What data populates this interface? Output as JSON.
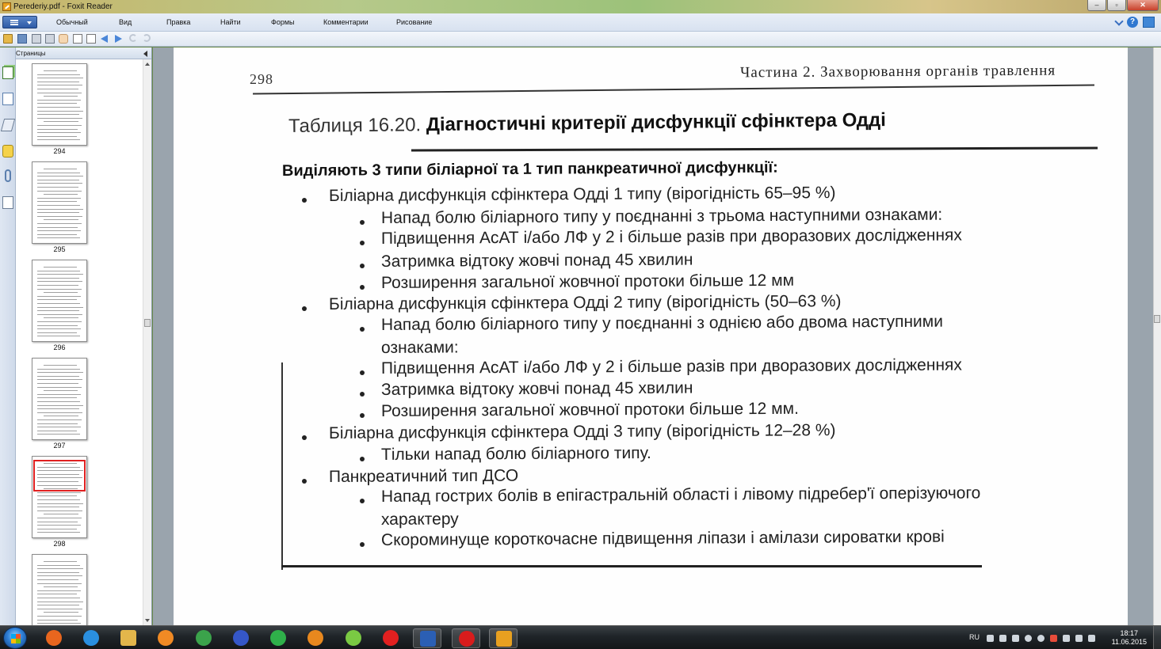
{
  "window": {
    "title": "Perederiy.pdf - Foxit Reader",
    "controls": [
      "‒",
      "▫",
      "✕"
    ]
  },
  "menu": {
    "items": [
      "Обычный",
      "Вид",
      "Правка",
      "Найти",
      "Формы",
      "Комментарии",
      "Рисование"
    ],
    "help_label": "?"
  },
  "sidebar": {
    "title": "Страницы",
    "thumbnails": [
      {
        "label": "294"
      },
      {
        "label": "295"
      },
      {
        "label": "296"
      },
      {
        "label": "297"
      },
      {
        "label": "298",
        "selected": true
      },
      {
        "label": ""
      }
    ]
  },
  "document": {
    "page_number": "298",
    "running_head": "Частина 2. Захворювання органів травлення",
    "caption_prefix": "Таблиця 16.20.",
    "caption_title": "Діагностичні критерії дисфункції сфінктера Одді",
    "intro": "Виділяють 3 типи біліарної та 1 тип панкреатичної дисфункції:",
    "items": [
      {
        "level": 1,
        "text": "Біліарна дисфункція сфінктера Одді 1 типу (вірогідність 65–95 %)"
      },
      {
        "level": 2,
        "text": "Напад болю біліарного типу у поєднанні з трьома наступними ознаками:"
      },
      {
        "level": 2,
        "text": "Підвищення АсАТ і/або ЛФ у 2 і більше разів при дворазових дослідженнях"
      },
      {
        "level": 2,
        "text": "Затримка відтоку жовчі понад 45 хвилин"
      },
      {
        "level": 2,
        "text": "Розширення загальної жовчної протоки більше 12 мм"
      },
      {
        "level": 1,
        "text": "Біліарна дисфункція сфінктера Одді 2 типу (вірогідність (50–63 %)"
      },
      {
        "level": 2,
        "text": "Напад болю біліарного типу у поєднанні з однією або двома наступними"
      },
      {
        "level": 3,
        "text": "ознаками:"
      },
      {
        "level": 2,
        "text": "Підвищення АсАТ і/або ЛФ у 2 і більше разів при дворазових дослідженнях"
      },
      {
        "level": 2,
        "text": "Затримка відтоку жовчі понад 45 хвилин"
      },
      {
        "level": 2,
        "text": "Розширення загальної жовчної протоки більше 12 мм."
      },
      {
        "level": 1,
        "text": "Біліарна дисфункція сфінктера Одді 3 типу (вірогідність 12–28 %)"
      },
      {
        "level": 2,
        "text": "Тільки напад болю біліарного типу."
      },
      {
        "level": 1,
        "text": "Панкреатичний тип ДСО"
      },
      {
        "level": 2,
        "text": "Напад гострих болів в епігастральній області і лівому підребер'ї оперізуючого"
      },
      {
        "level": 3,
        "text": "характеру"
      },
      {
        "level": 2,
        "text": "Скороминуще короткочасне підвищення ліпази і амілази сироватки крові"
      }
    ]
  },
  "taskbar": {
    "apps": [
      {
        "name": "firefox-icon",
        "color": "#e8661e"
      },
      {
        "name": "internet-explorer-icon",
        "color": "#2a8fe0"
      },
      {
        "name": "file-explorer-icon",
        "color": "#e3b64b"
      },
      {
        "name": "media-player-icon",
        "color": "#f08a24"
      },
      {
        "name": "chrome-icon",
        "color": "#3ba34b"
      },
      {
        "name": "daemon-tools-icon",
        "color": "#3557c8"
      },
      {
        "name": "butterfly-app-icon",
        "color": "#2fb04a"
      },
      {
        "name": "eye-app-icon",
        "color": "#e8881e"
      },
      {
        "name": "wifi-app-icon",
        "color": "#7ac943"
      },
      {
        "name": "yandex-browser-icon",
        "color": "#e22020"
      },
      {
        "name": "word-icon",
        "color": "#2b5fb4",
        "active": true
      },
      {
        "name": "opera-icon",
        "color": "#d81c1c",
        "active": true
      },
      {
        "name": "foxit-reader-icon",
        "color": "#e8a020",
        "active": true
      }
    ],
    "language": "RU",
    "time": "18:17",
    "date": "11.06.2015"
  }
}
